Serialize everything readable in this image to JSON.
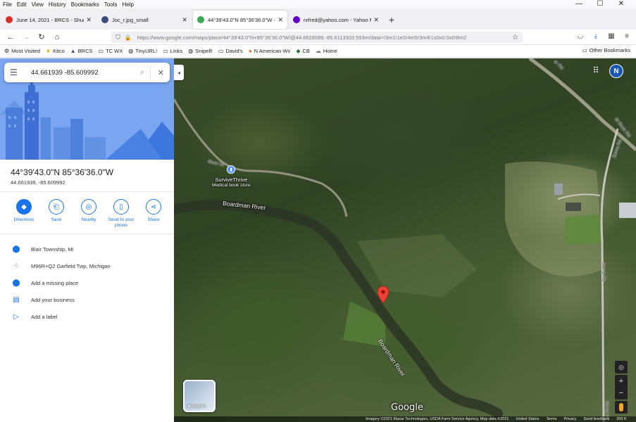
{
  "menu": [
    "File",
    "Edit",
    "View",
    "History",
    "Bookmarks",
    "Tools",
    "Help"
  ],
  "window_controls": {
    "minimize": "—",
    "maximize": "☐",
    "close": "✕"
  },
  "tabs": [
    {
      "label": "June 14, 2021 - BRCS - Shumsky",
      "color": "#d93025",
      "active": false
    },
    {
      "label": "Joc_r.jpg_small",
      "color": "#3c4b7a",
      "active": false
    },
    {
      "label": "44°39'43.0\"N 85°36'36.0\"W - Go",
      "color": "#34a853",
      "active": true
    },
    {
      "label": "nrfred@yahoo.com - Yahoo Ma",
      "color": "#6001d2",
      "active": false
    }
  ],
  "url": "https://www.google.com/maps/place/44°39'43.0\"N+85°36'36.0\"W/@44.6628589,-85.6113303,593m/data=!3m1!1e3!4m5!3m4!1s0x0:0x0!8m2",
  "bookmarks": [
    {
      "label": "Most Visited",
      "icon": "⚙"
    },
    {
      "label": "Kitco",
      "icon": "★"
    },
    {
      "label": "BRCS",
      "icon": "▲"
    },
    {
      "label": "TC WX",
      "icon": "▭"
    },
    {
      "label": "TinyURL!",
      "icon": "◍"
    },
    {
      "label": "Links",
      "icon": "▭"
    },
    {
      "label": "Snipell!",
      "icon": "◍"
    },
    {
      "label": "David's",
      "icon": "▭"
    },
    {
      "label": "N American Wx",
      "icon": "●"
    },
    {
      "label": "CB",
      "icon": "◆"
    },
    {
      "label": "Home",
      "icon": "☁"
    }
  ],
  "other_bookmarks": "Other Bookmarks",
  "search": {
    "value": "44.661939 -85.609992"
  },
  "place": {
    "title": "44°39'43.0\"N 85°36'36.0\"W",
    "subtitle": "44.661939, -85.609992"
  },
  "actions": [
    {
      "label": "Directions",
      "icon": "◆",
      "filled": true
    },
    {
      "label": "Save",
      "icon": "🔖",
      "filled": false
    },
    {
      "label": "Nearby",
      "icon": "◎",
      "filled": false
    },
    {
      "label": "Send to your phone",
      "icon": "▯",
      "filled": false
    },
    {
      "label": "Share",
      "icon": "<",
      "filled": false
    }
  ],
  "info_rows": [
    {
      "text": "Blair Township, MI",
      "icon": "📍"
    },
    {
      "text": "M96R+Q2 Garfield Twp, Michigan",
      "icon": "⁘"
    },
    {
      "text": "Add a missing place",
      "icon": "📍"
    },
    {
      "text": "Add your business",
      "icon": "▤"
    },
    {
      "text": "Add a label",
      "icon": "▷"
    }
  ],
  "map": {
    "account_initial": "N",
    "river_labels": [
      "Boardman River",
      "Boardman River"
    ],
    "road_labels": [
      "River Dr",
      "W River Rd",
      "Sarns Rd",
      "Sarns Rd",
      "Sarns Rd",
      "er Rd"
    ],
    "poi": {
      "name": "SurviveThrive",
      "category": "Medical book store"
    },
    "layers_label": "Layers",
    "logo": "Google",
    "attribution": [
      "Imagery ©2021 Maxar Technologies, USDA Farm Service Agency, Map data ©2021",
      "United States",
      "Terms",
      "Privacy",
      "Send feedback",
      "200 ft"
    ]
  }
}
